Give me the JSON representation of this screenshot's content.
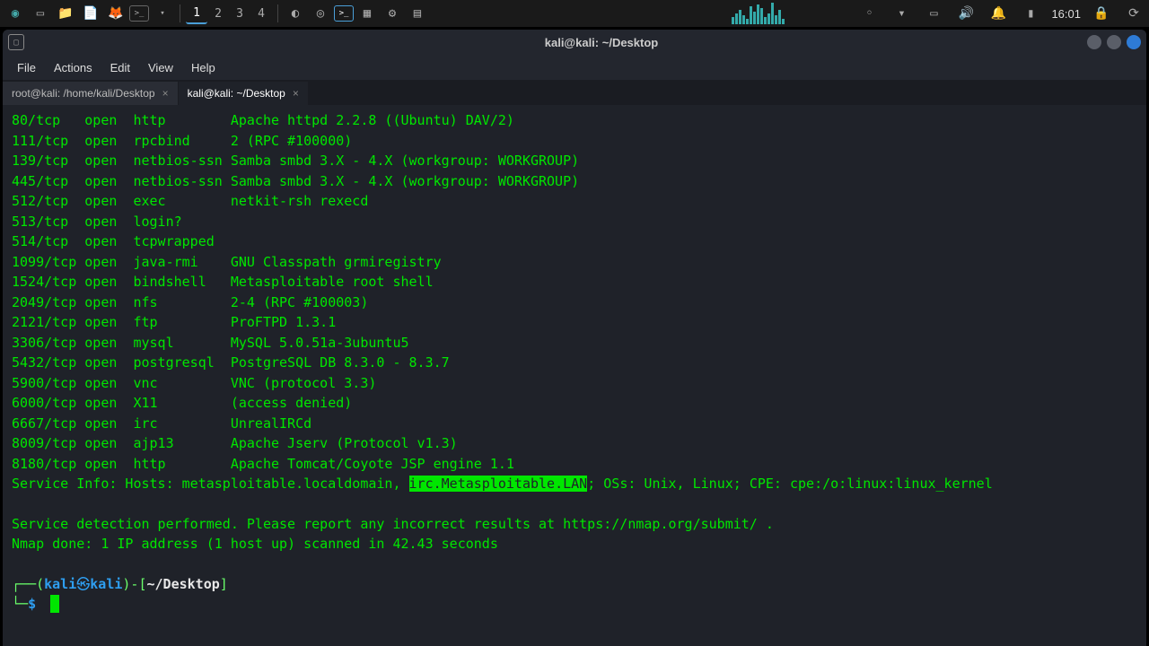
{
  "panel": {
    "workspaces": [
      "1",
      "2",
      "3",
      "4"
    ],
    "active_workspace": 0,
    "clock": "16:01"
  },
  "window": {
    "title": "kali@kali: ~/Desktop"
  },
  "menubar": {
    "file": "File",
    "actions": "Actions",
    "edit": "Edit",
    "view": "View",
    "help": "Help"
  },
  "tabs": [
    {
      "label": "root@kali: /home/kali/Desktop",
      "active": false
    },
    {
      "label": "kali@kali: ~/Desktop",
      "active": true
    }
  ],
  "terminal": {
    "ports": [
      {
        "port": "80/tcp   ",
        "state": "open  ",
        "service": "http        ",
        "version": "Apache httpd 2.2.8 ((Ubuntu) DAV/2)"
      },
      {
        "port": "111/tcp  ",
        "state": "open  ",
        "service": "rpcbind     ",
        "version": "2 (RPC #100000)"
      },
      {
        "port": "139/tcp  ",
        "state": "open  ",
        "service": "netbios-ssn ",
        "version": "Samba smbd 3.X - 4.X (workgroup: WORKGROUP)"
      },
      {
        "port": "445/tcp  ",
        "state": "open  ",
        "service": "netbios-ssn ",
        "version": "Samba smbd 3.X - 4.X (workgroup: WORKGROUP)"
      },
      {
        "port": "512/tcp  ",
        "state": "open  ",
        "service": "exec        ",
        "version": "netkit-rsh rexecd"
      },
      {
        "port": "513/tcp  ",
        "state": "open  ",
        "service": "login?",
        "version": ""
      },
      {
        "port": "514/tcp  ",
        "state": "open  ",
        "service": "tcpwrapped",
        "version": ""
      },
      {
        "port": "1099/tcp ",
        "state": "open  ",
        "service": "java-rmi    ",
        "version": "GNU Classpath grmiregistry"
      },
      {
        "port": "1524/tcp ",
        "state": "open  ",
        "service": "bindshell   ",
        "version": "Metasploitable root shell"
      },
      {
        "port": "2049/tcp ",
        "state": "open  ",
        "service": "nfs         ",
        "version": "2-4 (RPC #100003)"
      },
      {
        "port": "2121/tcp ",
        "state": "open  ",
        "service": "ftp         ",
        "version": "ProFTPD 1.3.1"
      },
      {
        "port": "3306/tcp ",
        "state": "open  ",
        "service": "mysql       ",
        "version": "MySQL 5.0.51a-3ubuntu5"
      },
      {
        "port": "5432/tcp ",
        "state": "open  ",
        "service": "postgresql  ",
        "version": "PostgreSQL DB 8.3.0 - 8.3.7"
      },
      {
        "port": "5900/tcp ",
        "state": "open  ",
        "service": "vnc         ",
        "version": "VNC (protocol 3.3)"
      },
      {
        "port": "6000/tcp ",
        "state": "open  ",
        "service": "X11         ",
        "version": "(access denied)"
      },
      {
        "port": "6667/tcp ",
        "state": "open  ",
        "service": "irc         ",
        "version": "UnrealIRCd"
      },
      {
        "port": "8009/tcp ",
        "state": "open  ",
        "service": "ajp13       ",
        "version": "Apache Jserv (Protocol v1.3)"
      },
      {
        "port": "8180/tcp ",
        "state": "open  ",
        "service": "http        ",
        "version": "Apache Tomcat/Coyote JSP engine 1.1"
      }
    ],
    "service_info_prefix": "Service Info: Hosts:  metasploitable.localdomain, ",
    "service_info_highlight": "irc.Metasploitable.LAN",
    "service_info_suffix": "; OSs: Unix, Linux; CPE: cpe:/o:linux:linux_kernel",
    "footer1": "Service detection performed. Please report any incorrect results at https://nmap.org/submit/ .",
    "footer2": "Nmap done: 1 IP address (1 host up) scanned in 42.43 seconds",
    "prompt": {
      "user": "kali",
      "host": "kali",
      "path": "~/Desktop",
      "symbol": "$"
    }
  }
}
